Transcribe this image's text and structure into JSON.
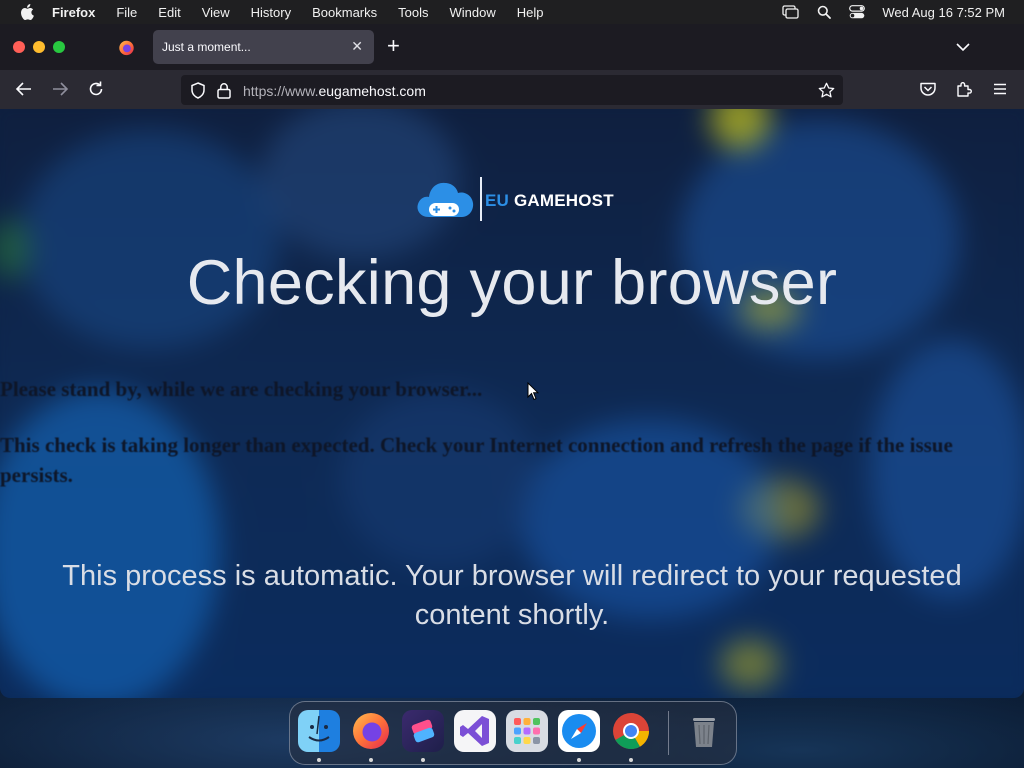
{
  "menubar": {
    "app_name": "Firefox",
    "items": [
      "File",
      "Edit",
      "View",
      "History",
      "Bookmarks",
      "Tools",
      "Window",
      "Help"
    ],
    "clock": "Wed Aug 16  7:52 PM"
  },
  "browser": {
    "tab_title": "Just a moment...",
    "url_prefix": "https://www.",
    "url_host": "eugamehost.com"
  },
  "page": {
    "logo_eu": "EU",
    "logo_rest": " GAMEHOST",
    "headline": "Checking your browser",
    "standby": "Please stand by, while we are checking your browser...",
    "slow_notice": "This check is taking longer than expected. Check your Internet connection and refresh the page if the issue persists.",
    "automatic": "This process is automatic. Your browser will redirect to your requested content shortly."
  },
  "dock": {
    "apps": [
      "finder",
      "firefox",
      "shortcuts",
      "visual-studio",
      "launchpad",
      "safari",
      "chrome"
    ],
    "trash": "trash"
  },
  "colors": {
    "brand_blue": "#2c8fe6",
    "tab_active": "#42414d",
    "navbar": "#2b2a33"
  }
}
